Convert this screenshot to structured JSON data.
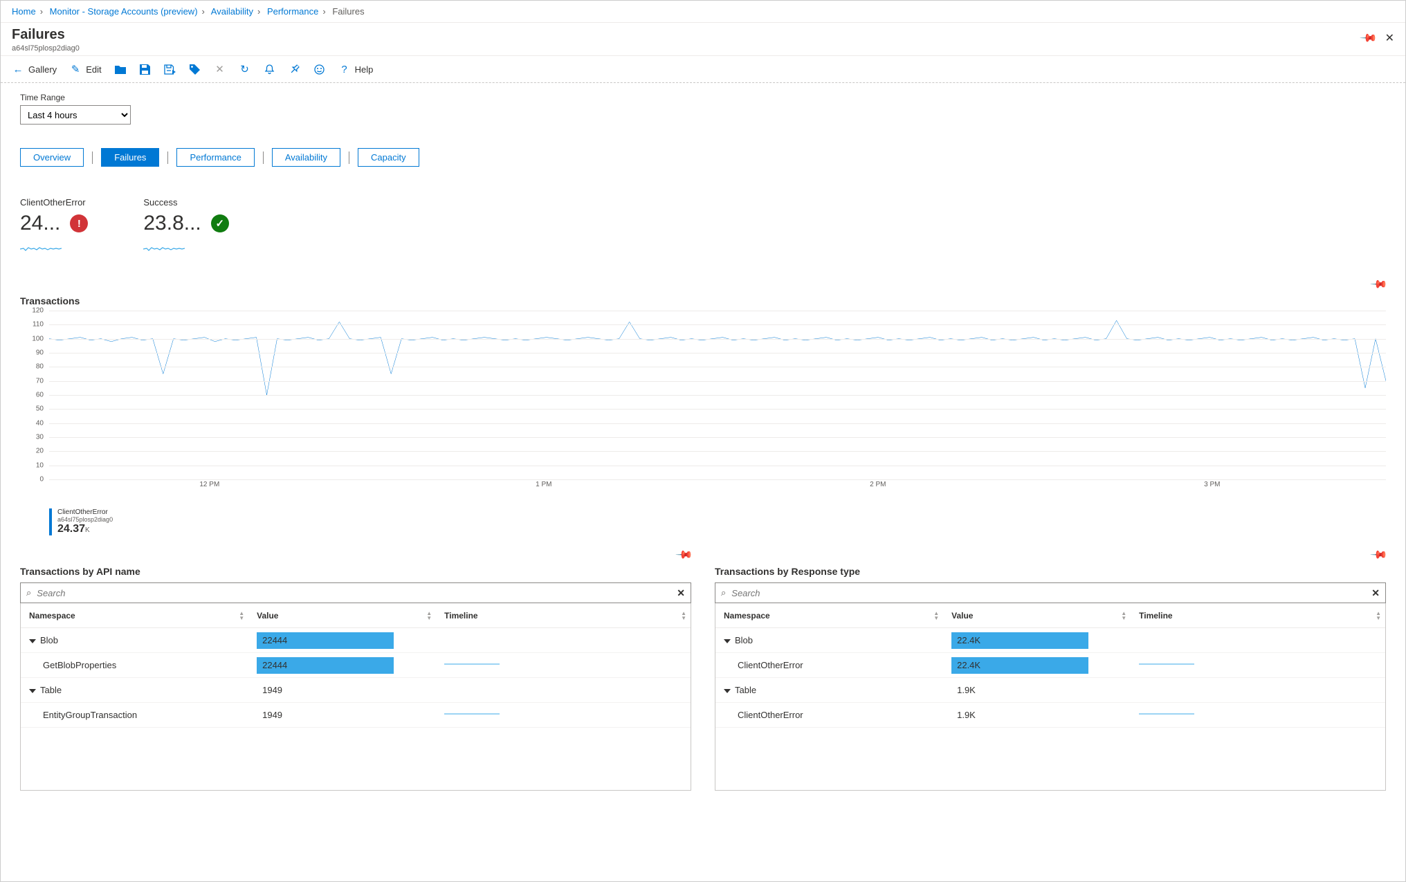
{
  "breadcrumb": {
    "items": [
      "Home",
      "Monitor - Storage Accounts (preview)",
      "Availability",
      "Performance",
      "Failures"
    ]
  },
  "page": {
    "title": "Failures",
    "subtitle": "a64sl75plosp2diag0"
  },
  "toolbar": {
    "gallery": "Gallery",
    "edit": "Edit",
    "help": "Help"
  },
  "time_range": {
    "label": "Time Range",
    "value": "Last 4 hours"
  },
  "tabs": [
    "Overview",
    "Failures",
    "Performance",
    "Availability",
    "Capacity"
  ],
  "active_tab": 1,
  "kpis": [
    {
      "label": "ClientOtherError",
      "value": "24...",
      "status": "error",
      "status_symbol": "!"
    },
    {
      "label": "Success",
      "value": "23.8...",
      "status": "success",
      "status_symbol": "✓"
    }
  ],
  "transactions": {
    "title": "Transactions",
    "legend": {
      "name": "ClientOtherError",
      "account": "a64sl75plosp2diag0",
      "value": "24.37",
      "unit": "K"
    }
  },
  "chart_data": {
    "type": "line",
    "ylim": [
      0,
      120
    ],
    "yticks": [
      0,
      10,
      20,
      30,
      40,
      50,
      60,
      70,
      80,
      90,
      100,
      110,
      120
    ],
    "xlabels": [
      "12 PM",
      "1 PM",
      "2 PM",
      "3 PM"
    ],
    "xpositions": [
      0.12,
      0.37,
      0.62,
      0.87
    ],
    "series": [
      {
        "name": "ClientOtherError",
        "values": [
          100,
          99,
          100,
          101,
          99,
          100,
          98,
          100,
          101,
          99,
          100,
          75,
          100,
          99,
          100,
          101,
          98,
          100,
          99,
          100,
          101,
          60,
          100,
          99,
          100,
          101,
          99,
          100,
          112,
          100,
          99,
          100,
          101,
          75,
          100,
          99,
          100,
          101,
          99,
          100,
          99,
          100,
          101,
          100,
          99,
          100,
          99,
          100,
          101,
          100,
          99,
          100,
          101,
          100,
          99,
          100,
          112,
          100,
          99,
          100,
          101,
          99,
          100,
          99,
          100,
          101,
          99,
          100,
          99,
          100,
          101,
          99,
          100,
          99,
          100,
          101,
          99,
          100,
          99,
          100,
          101,
          99,
          100,
          99,
          100,
          101,
          99,
          100,
          99,
          100,
          101,
          99,
          100,
          99,
          100,
          101,
          99,
          100,
          99,
          100,
          101,
          99,
          100,
          113,
          100,
          99,
          100,
          101,
          99,
          100,
          99,
          100,
          101,
          99,
          100,
          99,
          100,
          101,
          99,
          100,
          99,
          100,
          101,
          99,
          100,
          99,
          100,
          65,
          100,
          70
        ]
      }
    ]
  },
  "tables": [
    {
      "title": "Transactions by API name",
      "search_placeholder": "Search",
      "columns": [
        "Namespace",
        "Value",
        "Timeline"
      ],
      "rows": [
        {
          "namespace": "Blob",
          "value": "22444",
          "bar": 1.0,
          "expandable": true,
          "timeline": false
        },
        {
          "namespace": "GetBlobProperties",
          "value": "22444",
          "bar": 1.0,
          "indent": true,
          "timeline": true
        },
        {
          "namespace": "Table",
          "value": "1949",
          "bar": 0,
          "expandable": true,
          "timeline": false
        },
        {
          "namespace": "EntityGroupTransaction",
          "value": "1949",
          "bar": 0,
          "indent": true,
          "timeline": true
        }
      ]
    },
    {
      "title": "Transactions by Response type",
      "search_placeholder": "Search",
      "columns": [
        "Namespace",
        "Value",
        "Timeline"
      ],
      "rows": [
        {
          "namespace": "Blob",
          "value": "22.4K",
          "bar": 1.0,
          "expandable": true,
          "timeline": false
        },
        {
          "namespace": "ClientOtherError",
          "value": "22.4K",
          "bar": 1.0,
          "indent": true,
          "timeline": true
        },
        {
          "namespace": "Table",
          "value": "1.9K",
          "bar": 0,
          "expandable": true,
          "timeline": false
        },
        {
          "namespace": "ClientOtherError",
          "value": "1.9K",
          "bar": 0,
          "indent": true,
          "timeline": true
        }
      ]
    }
  ]
}
